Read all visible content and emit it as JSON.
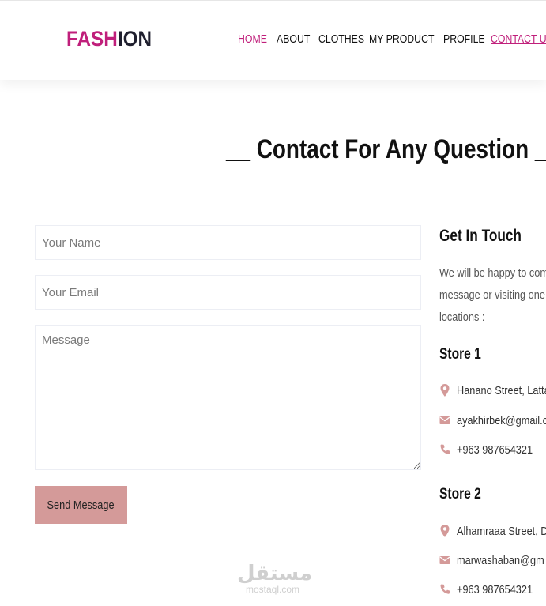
{
  "colors": {
    "brand": "#c01f7b",
    "button": "#d49a99",
    "icon": "#d49a99"
  },
  "header": {
    "logo_part1": "FASH",
    "logo_part2": "ION",
    "nav": [
      {
        "label": "HOME"
      },
      {
        "label": "ABOUT"
      },
      {
        "label": "CLOTHES"
      },
      {
        "label": "MY PRODUCT"
      },
      {
        "label": "PROFILE"
      },
      {
        "label": "CONTACT US"
      }
    ]
  },
  "main": {
    "title": "__ Contact For Any Question __"
  },
  "form": {
    "name_placeholder": "Your Name",
    "email_placeholder": "Your Email",
    "message_placeholder": "Message",
    "send_label": "Send Message"
  },
  "info": {
    "heading": "Get In Touch",
    "paragraph_lines": [
      "We will be happy to com",
      "message or visiting one",
      "locations :"
    ],
    "stores": [
      {
        "name": "Store 1",
        "address": "Hanano Street, Lattal",
        "email": "ayakhirbek@gmail.c",
        "phone": "+963 987654321"
      },
      {
        "name": "Store 2",
        "address": "Alhamraaa Street, Da",
        "email": "marwashaban@gm",
        "phone": "+963 987654321"
      }
    ]
  },
  "watermark": {
    "arabic": "مستقل",
    "latin": "mostaql.com"
  }
}
